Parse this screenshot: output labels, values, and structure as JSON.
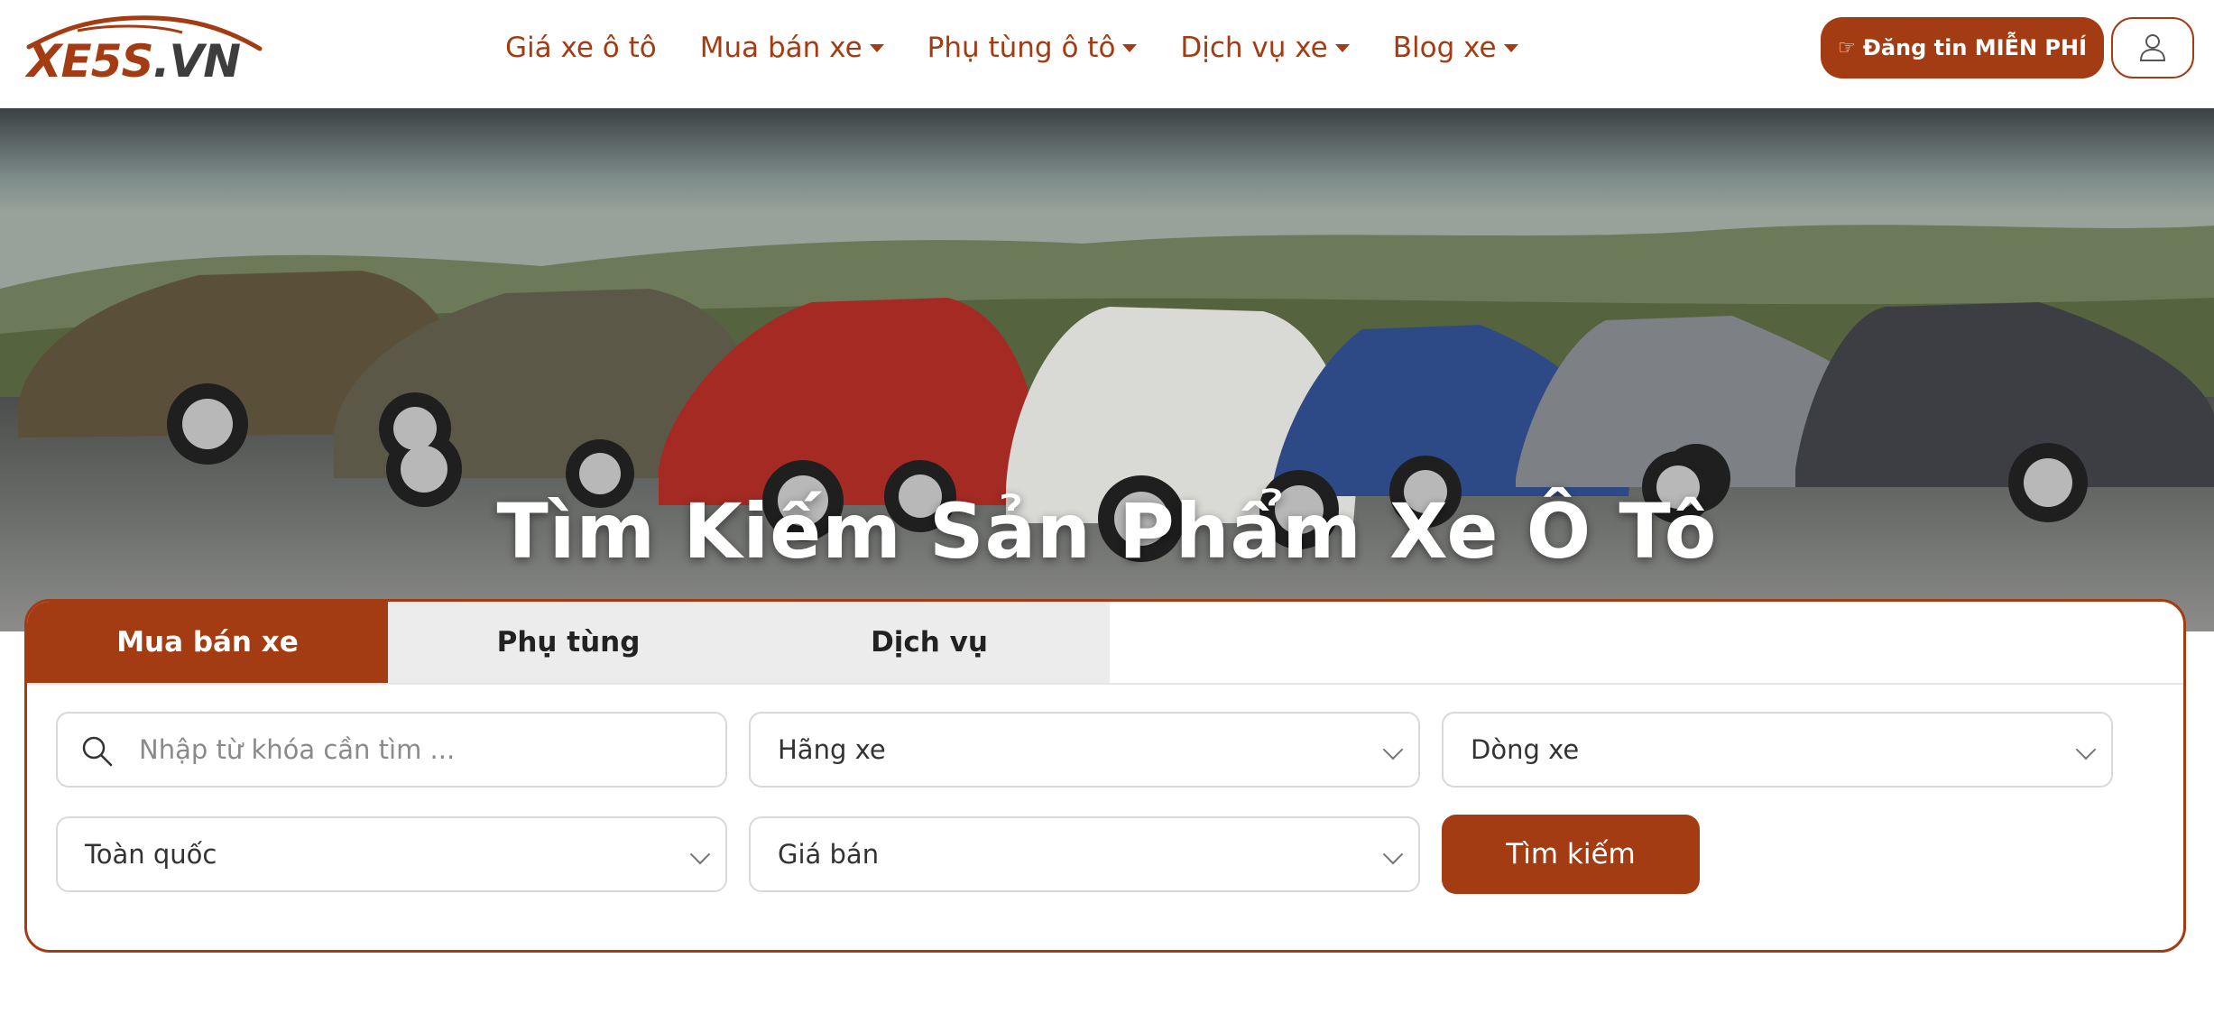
{
  "brand": {
    "logo_text_main": "XE5S",
    "logo_text_suffix": ".VN",
    "accent_color": "#a33b13"
  },
  "nav": {
    "items": [
      {
        "label": "Giá xe ô tô",
        "has_dropdown": false
      },
      {
        "label": "Mua bán xe",
        "has_dropdown": true
      },
      {
        "label": "Phụ tùng ô tô",
        "has_dropdown": true
      },
      {
        "label": "Dịch vụ xe",
        "has_dropdown": true
      },
      {
        "label": "Blog xe",
        "has_dropdown": true
      }
    ]
  },
  "header": {
    "post_button_label": "Đăng tin MIỄN PHÍ",
    "post_button_icon": "hand-pointer-icon",
    "user_button_icon": "user-icon"
  },
  "hero": {
    "title": "Tìm Kiếm Sản Phẩm Xe Ô Tô"
  },
  "search": {
    "tabs": [
      {
        "label": "Mua bán xe",
        "active": true
      },
      {
        "label": "Phụ tùng",
        "active": false
      },
      {
        "label": "Dịch vụ",
        "active": false
      }
    ],
    "keyword_placeholder": "Nhập từ khóa cần tìm ...",
    "brand_select": "Hãng xe",
    "model_select": "Dòng xe",
    "location_select": "Toàn quốc",
    "price_select": "Giá bán",
    "submit_label": "Tìm kiếm"
  }
}
